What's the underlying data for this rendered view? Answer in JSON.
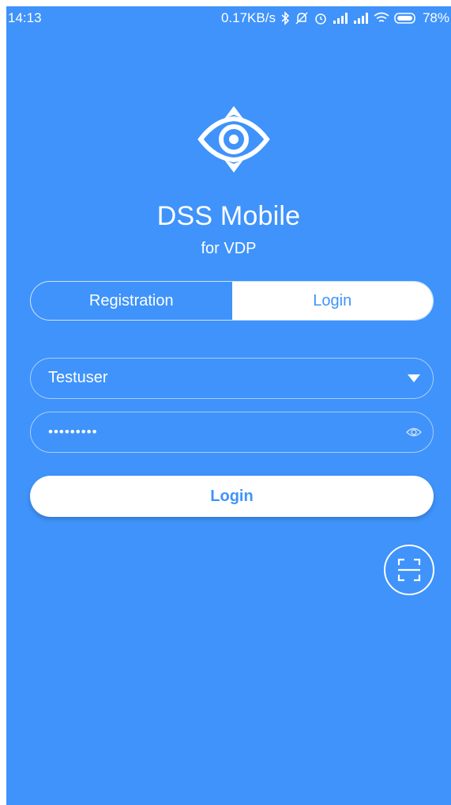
{
  "status_bar": {
    "time": "14:13",
    "network_speed": "0.17KB/s",
    "battery": "78%",
    "icons": [
      "bluetooth-icon",
      "mute-icon",
      "alarm-icon",
      "signal-icon",
      "signal-icon",
      "wifi-icon",
      "battery-icon"
    ]
  },
  "app": {
    "title": "DSS Mobile",
    "subtitle": "for VDP",
    "logo_icon": "eye-compass-logo"
  },
  "tabs": [
    {
      "label": "Registration",
      "active": false
    },
    {
      "label": "Login",
      "active": true
    }
  ],
  "form": {
    "username_value": "Testuser",
    "password_value": "•••••••••",
    "submit_label": "Login"
  },
  "scan_button": {
    "icon": "scan-icon"
  },
  "colors": {
    "background": "#3f93fb",
    "accent_text": "#3f93fb",
    "foreground": "#ffffff"
  }
}
